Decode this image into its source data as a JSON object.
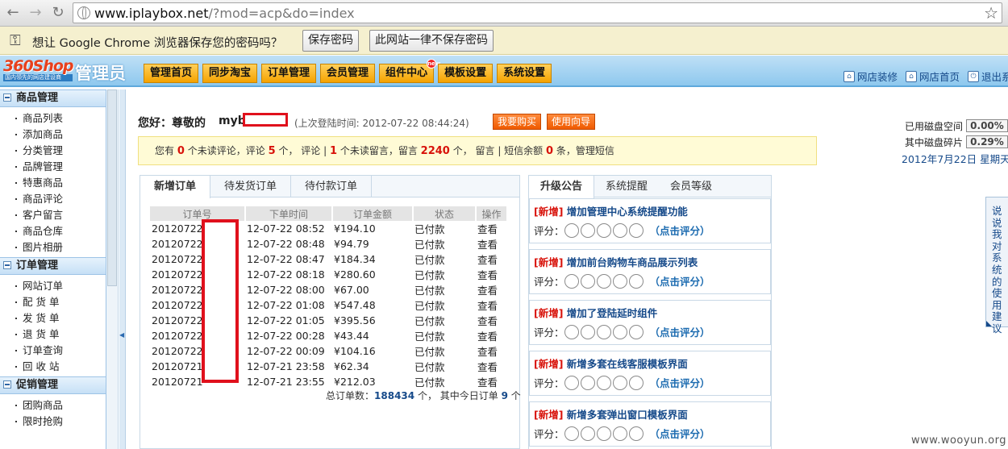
{
  "browser": {
    "url_host": "www.iplaybox.net",
    "url_path": "/?mod=acp&do=index",
    "back_icon": "back-arrow-icon",
    "forward_icon": "forward-arrow-icon",
    "reload_icon": "reload-icon",
    "star_icon": "bookmark-star-icon"
  },
  "infobar": {
    "message": "想让 Google Chrome 浏览器保存您的密码吗？",
    "save_label": "保存密码",
    "never_label": "此网站一律不保存密码"
  },
  "header": {
    "logo_main": "360Shop",
    "logo_sub": "国内领先的网店建设商",
    "role": "管理员",
    "nav": [
      "管理首页",
      "同步淘宝",
      "订单管理",
      "会员管理",
      "组件中心",
      "模板设置",
      "系统设置"
    ],
    "nav_badge": "new",
    "links": [
      "网店装修",
      "网店首页",
      "退出系"
    ]
  },
  "sidebar": {
    "sections": [
      {
        "title": "商品管理",
        "items": [
          "商品列表",
          "添加商品",
          "分类管理",
          "品牌管理",
          "特惠商品",
          "商品评论",
          "客户留言",
          "商品仓库",
          "图片相册"
        ]
      },
      {
        "title": "订单管理",
        "items": [
          "网站订单",
          "配 货 单",
          "发 货 单",
          "退 货 单",
          "订单查询",
          "回 收 站"
        ]
      },
      {
        "title": "促销管理",
        "items": [
          "团购商品",
          "限时抢购"
        ]
      }
    ]
  },
  "main": {
    "greeting": "您好：尊敬的",
    "user_prefix": "myb",
    "last_login": "(上次登陆时间: 2012-07-22 08:44:24)",
    "buy_button": "我要购买",
    "guide_button": "使用向导",
    "disk": {
      "used_label": "已用磁盘空间",
      "used_value": "0.00%",
      "frag_label": "其中磁盘碎片",
      "frag_value": "0.29%",
      "date": "2012年7月22日 星期天"
    },
    "notice": {
      "p1": "您有",
      "unread_comments": "0",
      "p2": "个未读评论，评论",
      "comments": "5",
      "p3": "个， 评论 |",
      "unread_msgs": "1",
      "p4": "个未读留言，留言",
      "msgs": "2240",
      "p5": "个， 留言 | 短信余额",
      "sms": "0",
      "p6": "条，管理短信"
    }
  },
  "orders": {
    "tabs": [
      "新增订单",
      "待发货订单",
      "待付款订单"
    ],
    "columns": [
      "订单号",
      "下单时间",
      "订单金额",
      "状态",
      "操作"
    ],
    "rows": [
      {
        "id": "20120722",
        "time": "12-07-22 08:52",
        "amount": "¥194.10",
        "status": "已付款",
        "action": "查看"
      },
      {
        "id": "20120722",
        "time": "12-07-22 08:48",
        "amount": "¥94.79",
        "status": "已付款",
        "action": "查看"
      },
      {
        "id": "20120722",
        "time": "12-07-22 08:47",
        "amount": "¥184.34",
        "status": "已付款",
        "action": "查看"
      },
      {
        "id": "20120722",
        "time": "12-07-22 08:18",
        "amount": "¥280.60",
        "status": "已付款",
        "action": "查看"
      },
      {
        "id": "20120722",
        "time": "12-07-22 08:00",
        "amount": "¥67.00",
        "status": "已付款",
        "action": "查看"
      },
      {
        "id": "20120722",
        "time": "12-07-22 01:08",
        "amount": "¥547.48",
        "status": "已付款",
        "action": "查看"
      },
      {
        "id": "20120722",
        "time": "12-07-22 01:05",
        "amount": "¥395.56",
        "status": "已付款",
        "action": "查看"
      },
      {
        "id": "20120722",
        "time": "12-07-22 00:28",
        "amount": "¥43.44",
        "status": "已付款",
        "action": "查看"
      },
      {
        "id": "20120722",
        "time": "12-07-22 00:09",
        "amount": "¥104.16",
        "status": "已付款",
        "action": "查看"
      },
      {
        "id": "20120721",
        "time": "12-07-21 23:58",
        "amount": "¥62.34",
        "status": "已付款",
        "action": "查看"
      },
      {
        "id": "20120721",
        "time": "12-07-21 23:55",
        "amount": "¥212.03",
        "status": "已付款",
        "action": "查看"
      }
    ],
    "total_p1": "总订单数：",
    "total": "188434",
    "total_p2": "个， 其中今日订单",
    "today": "9",
    "total_p3": "个"
  },
  "upgrade": {
    "tabs": [
      "升级公告",
      "系统提醒",
      "会员等级"
    ],
    "tag": "[新增]",
    "rate_label": "评分：",
    "rate_link": "（点击评分）",
    "items": [
      "增加管理中心系统提醒功能",
      "增加前台购物车商品展示列表",
      "增加了登陆延时组件",
      "新增多套在线客服模板界面",
      "新增多套弹出窗口模板界面"
    ]
  },
  "feedback": "说说我对系统的使用建议",
  "watermark": "www.wooyun.org"
}
